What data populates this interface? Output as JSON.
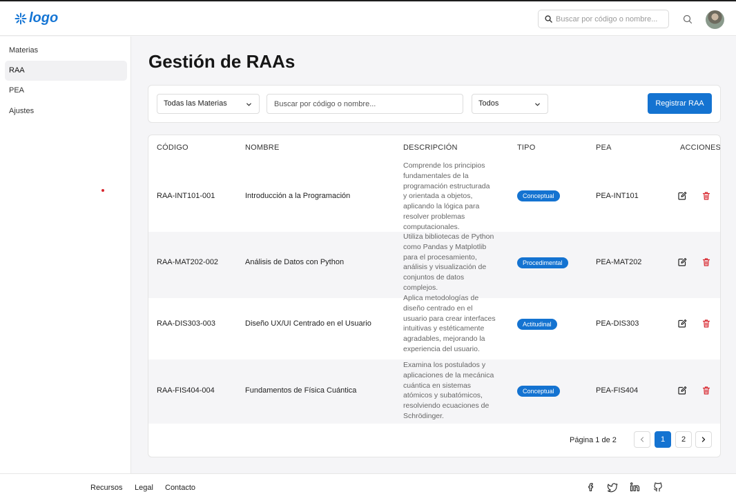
{
  "header": {
    "logo_text": "logo",
    "search_placeholder": "Buscar por código o nombre...",
    "accent_color": "#1473d1"
  },
  "sidebar": {
    "items": [
      {
        "label": "Materias",
        "active": false
      },
      {
        "label": "RAA",
        "active": true
      },
      {
        "label": "PEA",
        "active": false
      },
      {
        "label": "Ajustes",
        "active": false
      }
    ]
  },
  "main": {
    "title": "Gestión de RAAs",
    "filters": {
      "subject_select": "Todas las Materias",
      "search_placeholder": "Buscar por código o nombre...",
      "type_select": "Todos",
      "register_button": "Registrar RAA"
    },
    "table": {
      "columns": [
        "CÓDIGO",
        "NOMBRE",
        "DESCRIPCIÓN",
        "TIPO",
        "PEA",
        "ACCIONES"
      ],
      "rows": [
        {
          "code": "RAA-INT101-001",
          "name": "Introducción a la Programación",
          "description": [
            "Comprende los principios",
            "fundamentales de la",
            "programación estructurada",
            "y orientada a objetos,",
            "aplicando la lógica para",
            "resolver problemas",
            "computacionales."
          ],
          "type": "Conceptual",
          "pea": "PEA-INT101"
        },
        {
          "code": "RAA-MAT202-002",
          "name": "Análisis de Datos con Python",
          "description": [
            "Utiliza bibliotecas de Python",
            "como Pandas y Matplotlib",
            "para el procesamiento,",
            "análisis y visualización de",
            "conjuntos de datos",
            "complejos."
          ],
          "type": "Procedimental",
          "pea": "PEA-MAT202"
        },
        {
          "code": "RAA-DIS303-003",
          "name": "Diseño UX/UI Centrado en el Usuario",
          "description": [
            "Aplica metodologías de",
            "diseño centrado en el",
            "usuario para crear interfaces",
            "intuitivas y estéticamente",
            "agradables, mejorando la",
            "experiencia del usuario."
          ],
          "type": "Actitudinal",
          "pea": "PEA-DIS303"
        },
        {
          "code": "RAA-FIS404-004",
          "name": "Fundamentos de Física Cuántica",
          "description": [
            "Examina los postulados y",
            "aplicaciones de la mecánica",
            "cuántica en sistemas",
            "atómicos y subatómicos,",
            "resolviendo ecuaciones de",
            "Schrödinger."
          ],
          "type": "Conceptual",
          "pea": "PEA-FIS404"
        }
      ]
    },
    "pagination": {
      "label": "Página 1 de 2",
      "pages": [
        "1",
        "2"
      ],
      "current": "1"
    }
  },
  "footer": {
    "links": [
      "Recursos",
      "Legal",
      "Contacto"
    ],
    "social_icons": [
      "facebook-icon",
      "twitter-icon",
      "linkedin-icon",
      "github-icon"
    ]
  }
}
